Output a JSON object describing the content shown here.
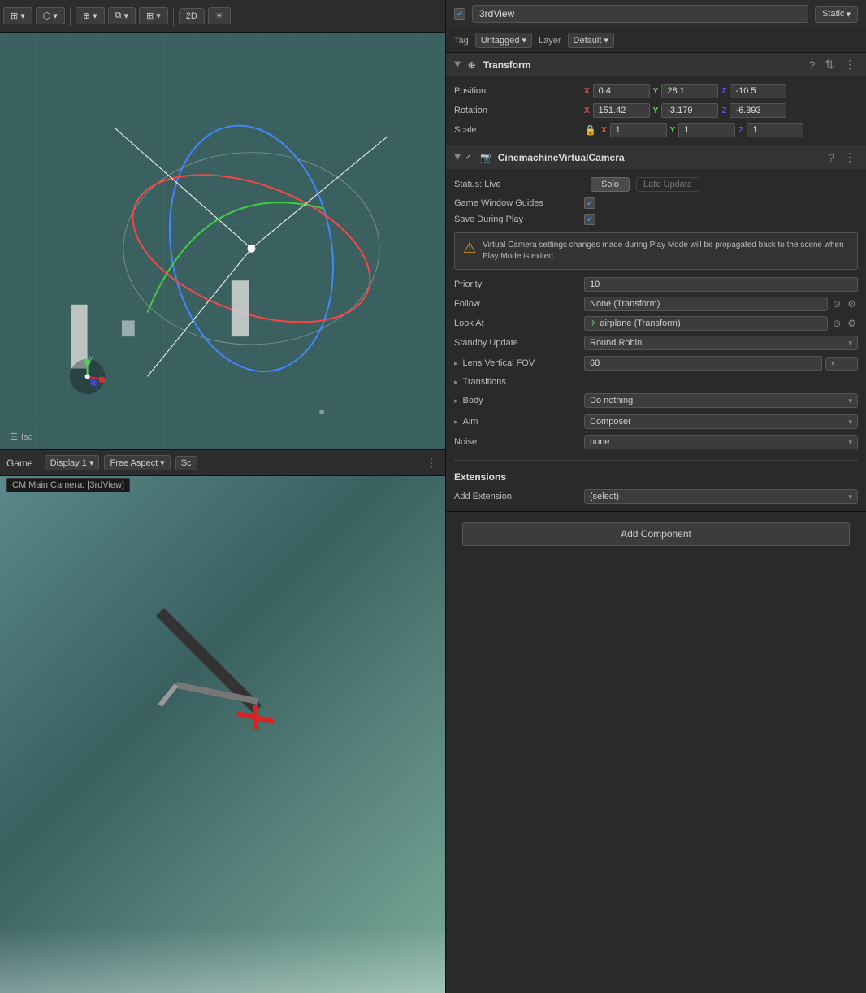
{
  "toolbar": {
    "buttons": [
      "⊞▾",
      "⬡▾",
      "⊕▾",
      "⧉▾",
      "⊞▾",
      "2D",
      "☀"
    ]
  },
  "scene": {
    "label": "Iso",
    "grid_visible": true
  },
  "game_view": {
    "title": "Game",
    "camera_label": "CM Main Camera: [3rdView]",
    "display": "Display 1",
    "aspect": "Free Aspect",
    "scale_label": "Sc"
  },
  "inspector": {
    "header": {
      "name": "3rdView",
      "static_label": "Static",
      "checkbox_checked": true
    },
    "tag_layer": {
      "tag_label": "Tag",
      "tag_value": "Untagged",
      "layer_label": "Layer",
      "layer_value": "Default"
    },
    "transform": {
      "title": "Transform",
      "position_label": "Position",
      "pos_x": "0.4",
      "pos_y": "28.1",
      "pos_z": "-10.5",
      "rotation_label": "Rotation",
      "rot_x": "151.42",
      "rot_y": "-3.179",
      "rot_z": "-6.393",
      "scale_label": "Scale",
      "scale_x": "1",
      "scale_y": "1",
      "scale_z": "1",
      "x_label": "X",
      "y_label": "Y",
      "z_label": "Z"
    },
    "cinemachine": {
      "title": "CinemachineVirtualCamera",
      "status_label": "Status: Live",
      "solo_label": "Solo",
      "late_update_label": "Late Update",
      "game_window_guides_label": "Game Window Guides",
      "game_window_guides_checked": true,
      "save_during_play_label": "Save During Play",
      "save_during_play_checked": true,
      "warning_text": "Virtual Camera settings changes made during Play Mode will be propagated back to the scene when Play Mode is exited.",
      "priority_label": "Priority",
      "priority_value": "10",
      "follow_label": "Follow",
      "follow_value": "None (Transform)",
      "look_at_label": "Look At",
      "look_at_value": "airplane (Transform)",
      "standby_update_label": "Standby Update",
      "standby_update_value": "Round Robin",
      "lens_fov_label": "Lens Vertical FOV",
      "lens_fov_value": "60",
      "transitions_label": "Transitions",
      "body_label": "Body",
      "body_value": "Do nothing",
      "aim_label": "Aim",
      "aim_value": "Composer",
      "noise_label": "Noise",
      "noise_value": "none",
      "extensions_label": "Extensions",
      "add_extension_label": "Add Extension",
      "add_extension_value": "(select)"
    },
    "add_component_label": "Add Component"
  }
}
